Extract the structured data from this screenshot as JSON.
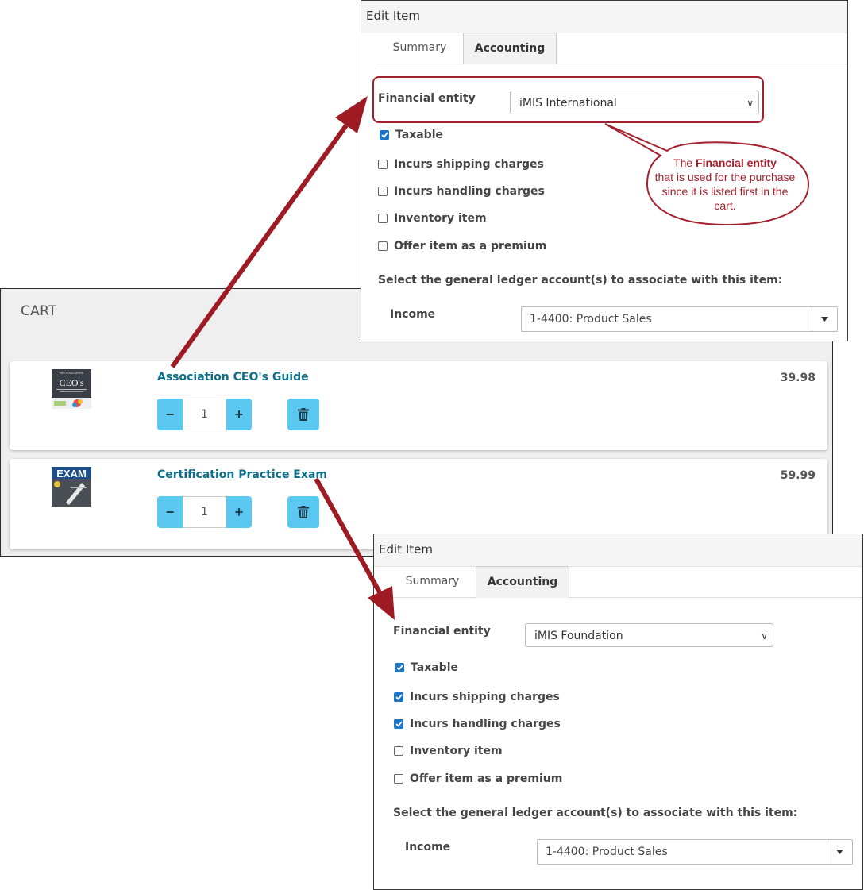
{
  "cart": {
    "title": "CART",
    "items": [
      {
        "name": "Association CEO's Guide",
        "price": "39.98",
        "qty": "1",
        "minus": "−",
        "plus": "+"
      },
      {
        "name": "Certification Practice Exam",
        "price": "59.99",
        "qty": "1",
        "minus": "−",
        "plus": "+"
      }
    ]
  },
  "thumbs": {
    "ceo_title": "CEO's",
    "ceo_top": "THE ASSOCIATION",
    "exam_title": "EXAM"
  },
  "panel1": {
    "title": "Edit Item",
    "tabs": [
      "Summary",
      "Accounting"
    ],
    "financial_label": "Financial entity",
    "financial_value": "iMIS International",
    "checkboxes": [
      {
        "label": "Taxable",
        "checked": true
      },
      {
        "label": "Incurs shipping charges",
        "checked": false
      },
      {
        "label": "Incurs handling charges",
        "checked": false
      },
      {
        "label": "Inventory item",
        "checked": false
      },
      {
        "label": "Offer item as a premium",
        "checked": false
      }
    ],
    "gl_text": "Select the general ledger account(s) to associate with this item:",
    "income_label": "Income",
    "income_value": "1-4400: Product Sales"
  },
  "panel2": {
    "title": "Edit Item",
    "tabs": [
      "Summary",
      "Accounting"
    ],
    "financial_label": "Financial entity",
    "financial_value": "iMIS Foundation",
    "checkboxes": [
      {
        "label": "Taxable",
        "checked": true
      },
      {
        "label": "Incurs shipping charges",
        "checked": true
      },
      {
        "label": "Incurs handling charges",
        "checked": true
      },
      {
        "label": "Inventory item",
        "checked": false
      },
      {
        "label": "Offer item as a premium",
        "checked": false
      }
    ],
    "gl_text": "Select the general ledger account(s) to associate with this item:",
    "income_label": "Income",
    "income_value": "1-4400: Product Sales"
  },
  "callout": {
    "pre": "The ",
    "bold": "Financial entity",
    "post": "that is used for the purchase since it is listed first in the cart."
  },
  "colors": {
    "accent_red": "#a3202d",
    "link_teal": "#0d6e8a",
    "button_blue": "#5bc8f2",
    "checkbox_blue": "#1b74c5"
  }
}
